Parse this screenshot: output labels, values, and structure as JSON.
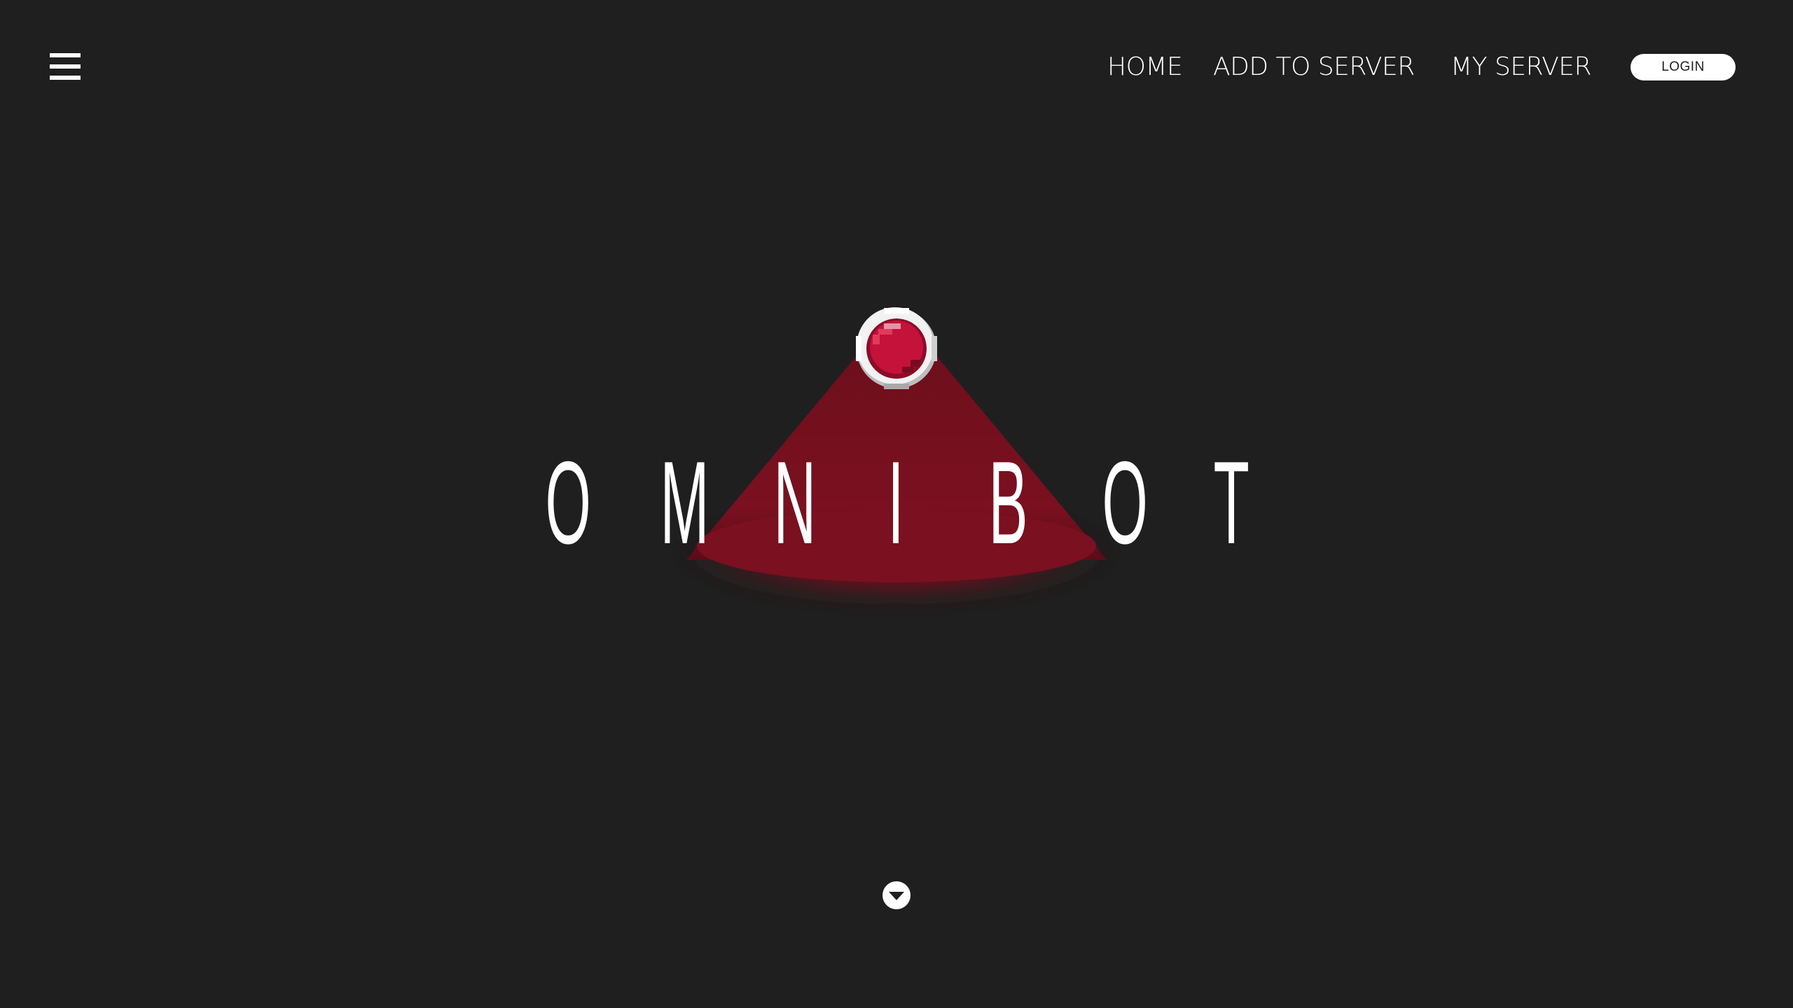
{
  "header": {
    "menu_icon": "hamburger-menu-icon",
    "nav": {
      "home": "HOME",
      "add_to_server": "ADD TO SERVER",
      "my_server": "MY SERVER"
    },
    "login_label": "LOGIN"
  },
  "hero": {
    "logo_letters": [
      "O",
      "M",
      "N",
      "I",
      "B",
      "O",
      "T"
    ],
    "light_icon": "red-beacon-light-icon",
    "scroll_icon": "chevron-down-circle-icon"
  },
  "colors": {
    "background": "#1f1f1f",
    "text": "#ffffff",
    "beam": "#7a1020",
    "beacon_red": "#c4123a",
    "beacon_ring": "#e0e0e0"
  }
}
